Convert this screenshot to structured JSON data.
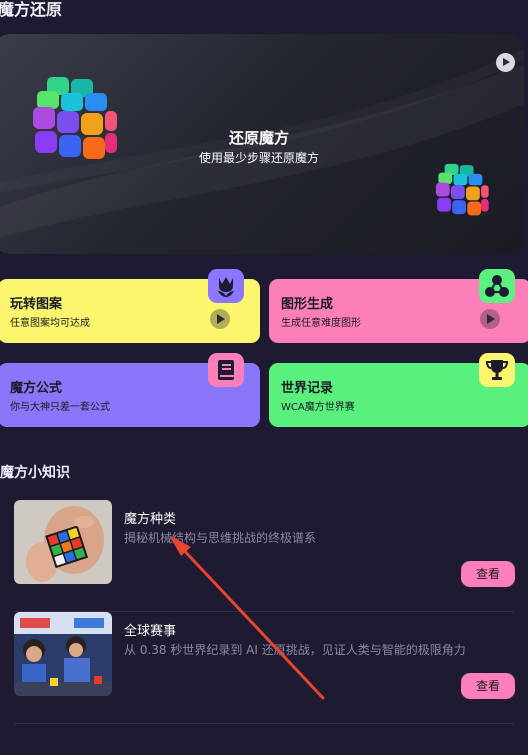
{
  "header": {
    "title": "魔方还原"
  },
  "hero": {
    "title": "还原魔方",
    "subtitle": "使用最少步骤还原魔方"
  },
  "cards": [
    {
      "title": "玩转图案",
      "subtitle": "任意图案均可达成",
      "icon": "tulip-icon",
      "badge_color": "#8b77fb"
    },
    {
      "title": "图形生成",
      "subtitle": "生成任意难度图形",
      "icon": "graph-nodes-icon",
      "badge_color": "#5cf07f"
    },
    {
      "title": "魔方公式",
      "subtitle": "你与大神只差一套公式",
      "icon": "book-icon",
      "badge_color": "#fd7fb9"
    },
    {
      "title": "世界记录",
      "subtitle": "WCA魔方世界赛",
      "icon": "trophy-icon",
      "badge_color": "#fbf66e"
    }
  ],
  "knowledge": {
    "title": "魔方小知识",
    "items": [
      {
        "title": "魔方种类",
        "desc": "揭秘机械结构与思维挑战的终极谱系",
        "button": "查看"
      },
      {
        "title": "全球赛事",
        "desc": "从 0.38 秒世界纪录到 AI 还原挑战，见证人类与智能的极限角力",
        "button": "查看"
      }
    ]
  },
  "colors": {
    "background": "#1d1a32",
    "yellow": "#fbf66e",
    "pink": "#fd7fb9",
    "purple": "#8a76f9",
    "green": "#59f07e",
    "arrow": "#e8442e"
  }
}
